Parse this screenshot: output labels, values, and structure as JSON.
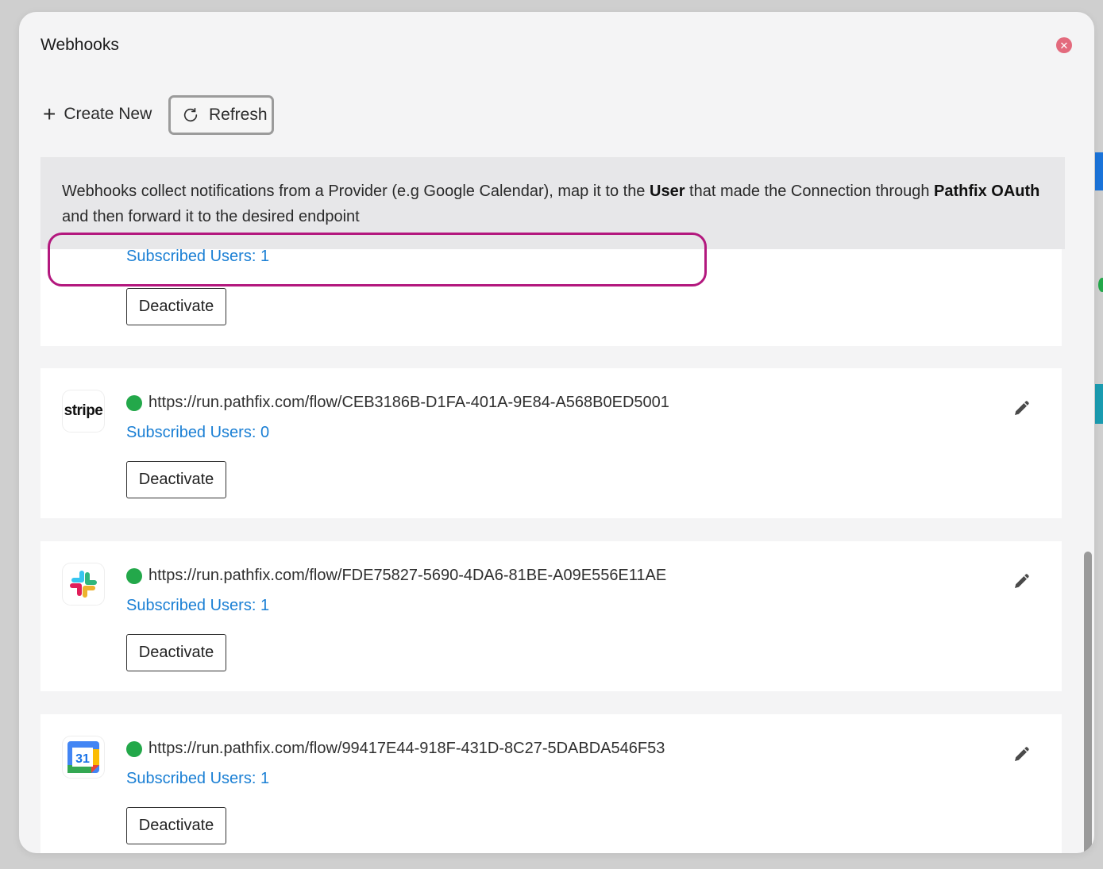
{
  "modal": {
    "title": "Webhooks",
    "close_icon": "close-icon"
  },
  "toolbar": {
    "create_label": "Create New",
    "refresh_label": "Refresh"
  },
  "info": {
    "part1": "Webhooks collect notifications from a Provider (e.g Google Calendar), map it to the ",
    "bold1": "User",
    "part2": " that made the Connection through ",
    "bold2": "Pathfix OAuth",
    "part3": " and then forward it to the desired endpoint"
  },
  "webhooks": [
    {
      "provider": "unknown",
      "subscribed": "Subscribed Users: 1",
      "deactivate_label": "Deactivate"
    },
    {
      "provider": "stripe",
      "logo_text": "stripe",
      "url": "https://run.pathfix.com/flow/CEB3186B-D1FA-401A-9E84-A568B0ED5001",
      "subscribed": "Subscribed Users: 0",
      "deactivate_label": "Deactivate",
      "status_color": "#23a84a"
    },
    {
      "provider": "slack",
      "url": "https://run.pathfix.com/flow/FDE75827-5690-4DA6-81BE-A09E556E11AE",
      "subscribed": "Subscribed Users: 1",
      "deactivate_label": "Deactivate",
      "status_color": "#23a84a"
    },
    {
      "provider": "google-calendar",
      "logo_text": "31",
      "url": "https://run.pathfix.com/flow/99417E44-918F-431D-8C27-5DABDA546F53",
      "subscribed": "Subscribed Users: 1",
      "deactivate_label": "Deactivate",
      "status_color": "#23a84a"
    }
  ],
  "colors": {
    "link_blue": "#1a7fd4",
    "status_green": "#23a84a",
    "highlight_magenta": "#b3187e",
    "close_red": "#e36a7d"
  }
}
